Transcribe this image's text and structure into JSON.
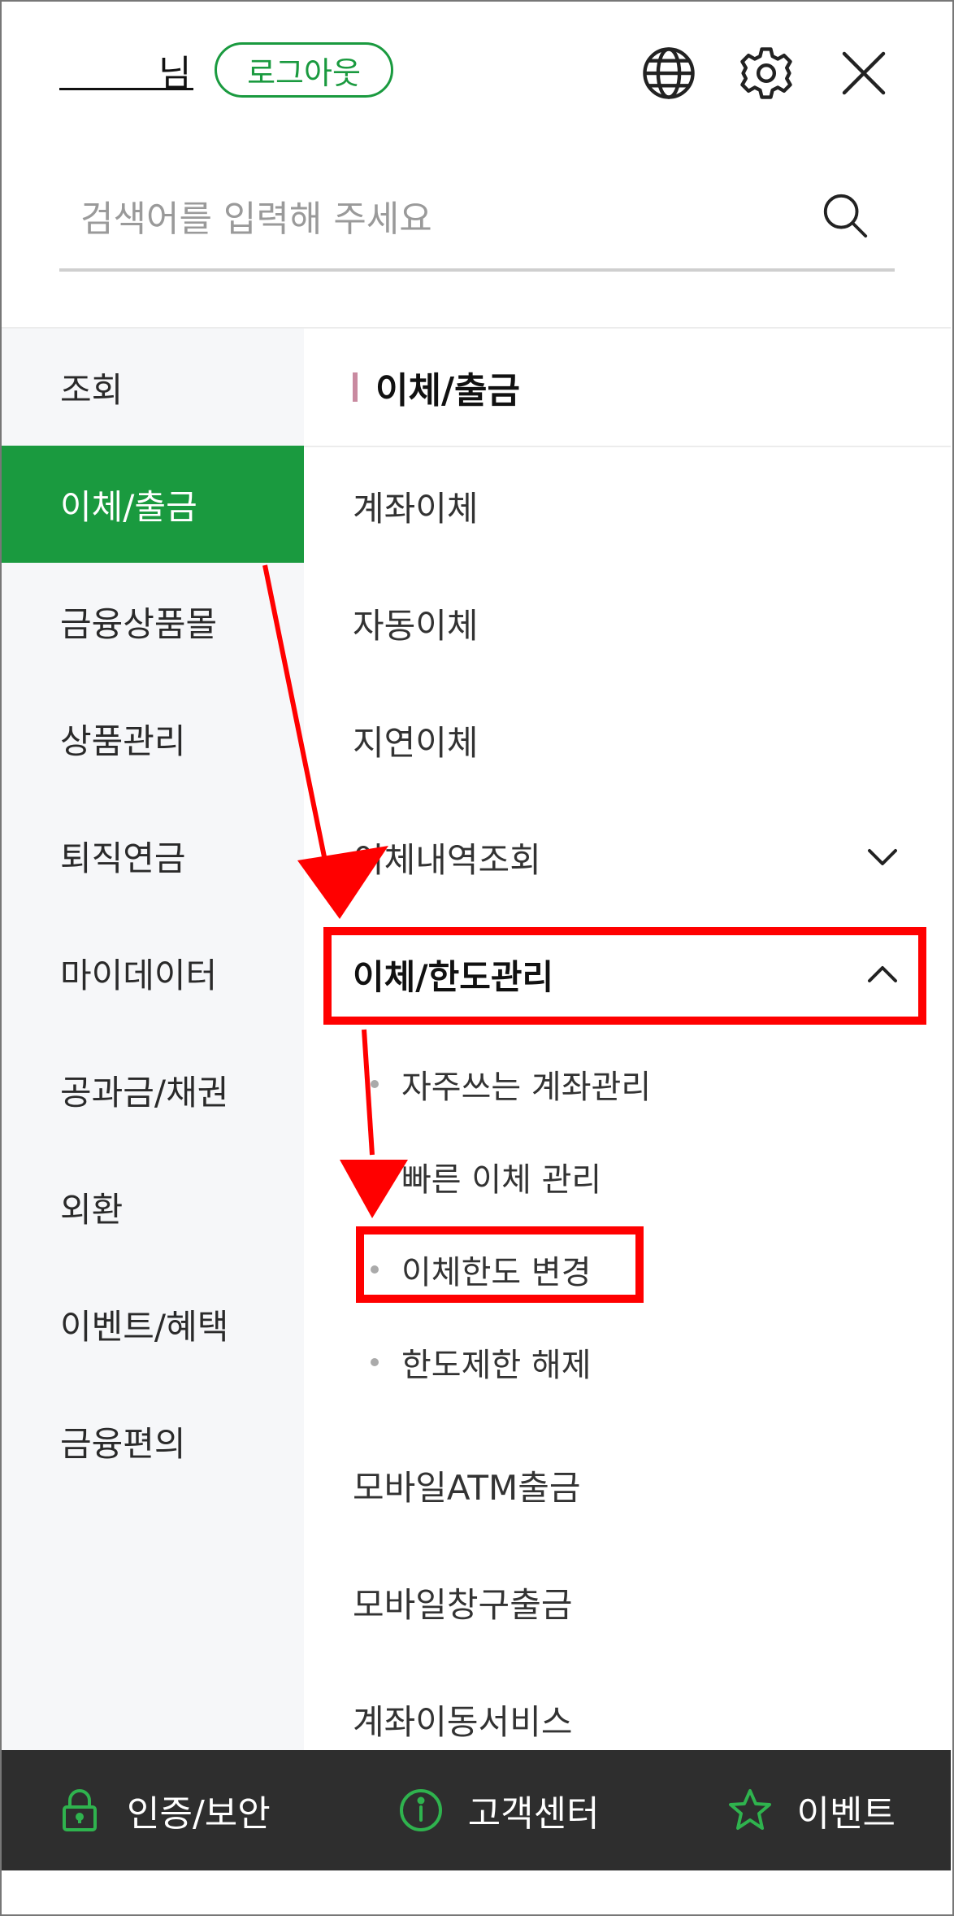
{
  "header": {
    "user_suffix": "님",
    "logout_label": "로그아웃",
    "icons": [
      "globe-icon",
      "gear-icon",
      "close-icon"
    ]
  },
  "search": {
    "placeholder": "검색어를 입력해 주세요"
  },
  "categories": [
    {
      "label": "조회"
    },
    {
      "label": "이체/출금",
      "active": true
    },
    {
      "label": "금융상품몰"
    },
    {
      "label": "상품관리"
    },
    {
      "label": "퇴직연금"
    },
    {
      "label": "마이데이터"
    },
    {
      "label": "공과금/채권"
    },
    {
      "label": "외환"
    },
    {
      "label": "이벤트/혜택"
    },
    {
      "label": "금융편의"
    }
  ],
  "section_title": "이체/출금",
  "menu": {
    "item1": "계좌이체",
    "item2": "자동이체",
    "item3": "지연이체",
    "item4": "이체내역조회",
    "item5": "이체/한도관리",
    "item6": "모바일ATM출금",
    "item7": "모바일창구출금",
    "item8": "계좌이동서비스"
  },
  "submenu": [
    "자주쓰는 계좌관리",
    "빠른 이체 관리",
    "이체한도 변경",
    "한도제한 해제"
  ],
  "bottom_bar": [
    {
      "label": "인증/보안",
      "icon": "lock-icon"
    },
    {
      "label": "고객센터",
      "icon": "info-icon"
    },
    {
      "label": "이벤트",
      "icon": "star-icon"
    }
  ],
  "colors": {
    "accent": "#1a9a3f",
    "highlight": "#ff0000",
    "bottom_bar": "#2e2e2e"
  }
}
